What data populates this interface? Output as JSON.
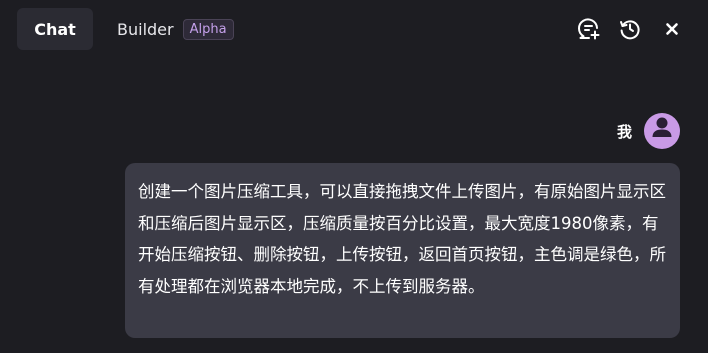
{
  "tabs": {
    "chat_label": "Chat",
    "builder_label": "Builder",
    "builder_badge": "Alpha"
  },
  "toolbar": {
    "icons": [
      "new-chat-icon",
      "history-icon",
      "close-icon"
    ]
  },
  "message": {
    "sender": "我",
    "avatar_icon": "user-icon",
    "text": "创建一个图片压缩工具，可以直接拖拽文件上传图片，有原始图片显示区和压缩后图片显示区，压缩质量按百分比设置，最大宽度1980像素，有开始压缩按钮、删除按钮，上传按钮，返回首页按钮，主色调是绿色，所有处理都在浏览器本地完成，不上传到服务器。"
  },
  "colors": {
    "background": "#1d1d22",
    "active_tab": "#2b2b33",
    "bubble": "#3b3b46",
    "avatar": "#c99ae6",
    "badge_text": "#c4a0ea"
  }
}
